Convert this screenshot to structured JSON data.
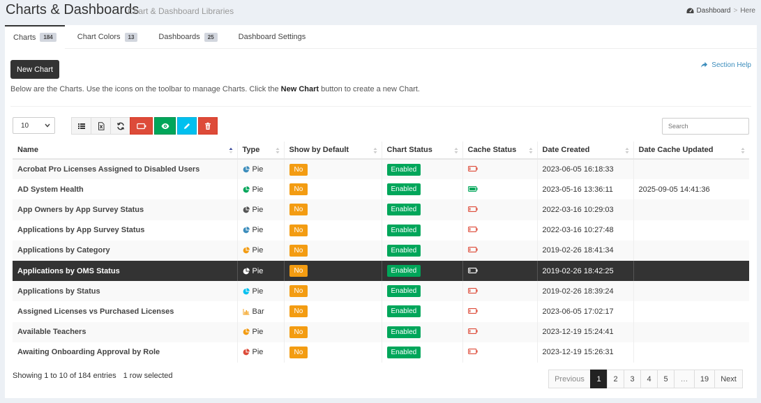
{
  "header": {
    "title": "Charts & Dashboards",
    "subtitle": "Chart & Dashboard Libraries",
    "breadcrumb": {
      "dashboard": "Dashboard",
      "separator": ">",
      "here": "Here"
    }
  },
  "tabs": [
    {
      "label": "Charts",
      "count": "184"
    },
    {
      "label": "Chart Colors",
      "count": "13"
    },
    {
      "label": "Dashboards",
      "count": "25"
    },
    {
      "label": "Dashboard Settings"
    }
  ],
  "toolbar": {
    "new_chart_label": "New Chart",
    "section_help_label": "Section Help",
    "page_size": "10",
    "search_placeholder": "Search"
  },
  "intro": {
    "before": "Below are the Charts. Use the icons on the toolbar to manage Charts. Click the ",
    "bold": "New Chart",
    "after": " button to create a new Chart."
  },
  "table": {
    "columns": [
      "Name",
      "Type",
      "Show by Default",
      "Chart Status",
      "Cache Status",
      "Date Created",
      "Date Cache Updated"
    ],
    "rows": [
      {
        "name": "Acrobat Pro Licenses Assigned to Disabled Users",
        "type": "Pie",
        "type_color": "#3c8dbc",
        "show": "No",
        "status": "Enabled",
        "cache": "empty",
        "created": "2023-06-05 16:18:33",
        "updated": ""
      },
      {
        "name": "AD System Health",
        "type": "Pie",
        "type_color": "#00a65a",
        "show": "No",
        "status": "Enabled",
        "cache": "full",
        "created": "2023-05-16 13:36:11",
        "updated": "2025-09-05 14:41:36"
      },
      {
        "name": "App Owners by App Survey Status",
        "type": "Pie",
        "type_color": "#555555",
        "show": "No",
        "status": "Enabled",
        "cache": "empty",
        "created": "2022-03-16 10:29:03",
        "updated": ""
      },
      {
        "name": "Applications by App Survey Status",
        "type": "Pie",
        "type_color": "#3c8dbc",
        "show": "No",
        "status": "Enabled",
        "cache": "empty",
        "created": "2022-03-16 10:27:48",
        "updated": ""
      },
      {
        "name": "Applications by Category",
        "type": "Pie",
        "type_color": "#f39c12",
        "show": "No",
        "status": "Enabled",
        "cache": "empty",
        "created": "2019-02-26 18:41:34",
        "updated": ""
      },
      {
        "name": "Applications by OMS Status",
        "type": "Pie",
        "type_color": "#ffffff",
        "show": "No",
        "status": "Enabled",
        "cache": "empty",
        "created": "2019-02-26 18:42:25",
        "updated": "",
        "selected": true
      },
      {
        "name": "Applications by Status",
        "type": "Pie",
        "type_color": "#00c0ef",
        "show": "No",
        "status": "Enabled",
        "cache": "empty",
        "created": "2019-02-26 18:39:24",
        "updated": ""
      },
      {
        "name": "Assigned Licenses vs Purchased Licenses",
        "type": "Bar",
        "type_color": "#f39c12",
        "show": "No",
        "status": "Enabled",
        "cache": "empty",
        "created": "2023-06-05 17:02:17",
        "updated": ""
      },
      {
        "name": "Available Teachers",
        "type": "Pie",
        "type_color": "#f39c12",
        "show": "No",
        "status": "Enabled",
        "cache": "empty",
        "created": "2023-12-19 15:24:41",
        "updated": ""
      },
      {
        "name": "Awaiting Onboarding Approval by Role",
        "type": "Pie",
        "type_color": "#dd4b39",
        "show": "No",
        "status": "Enabled",
        "cache": "empty",
        "created": "2023-12-19 15:26:31",
        "updated": ""
      }
    ]
  },
  "footer": {
    "showing": "Showing 1 to 10 of 184 entries",
    "selected": "1 row selected"
  },
  "pagination": {
    "previous": "Previous",
    "pages": [
      "1",
      "2",
      "3",
      "4",
      "5"
    ],
    "ellipsis": "…",
    "last": "19",
    "next": "Next",
    "current": "1"
  },
  "colors": {
    "accent": "#3c8dbc",
    "danger": "#dd4b39",
    "success": "#00a65a",
    "info": "#00c0ef",
    "warning": "#f39c12"
  }
}
